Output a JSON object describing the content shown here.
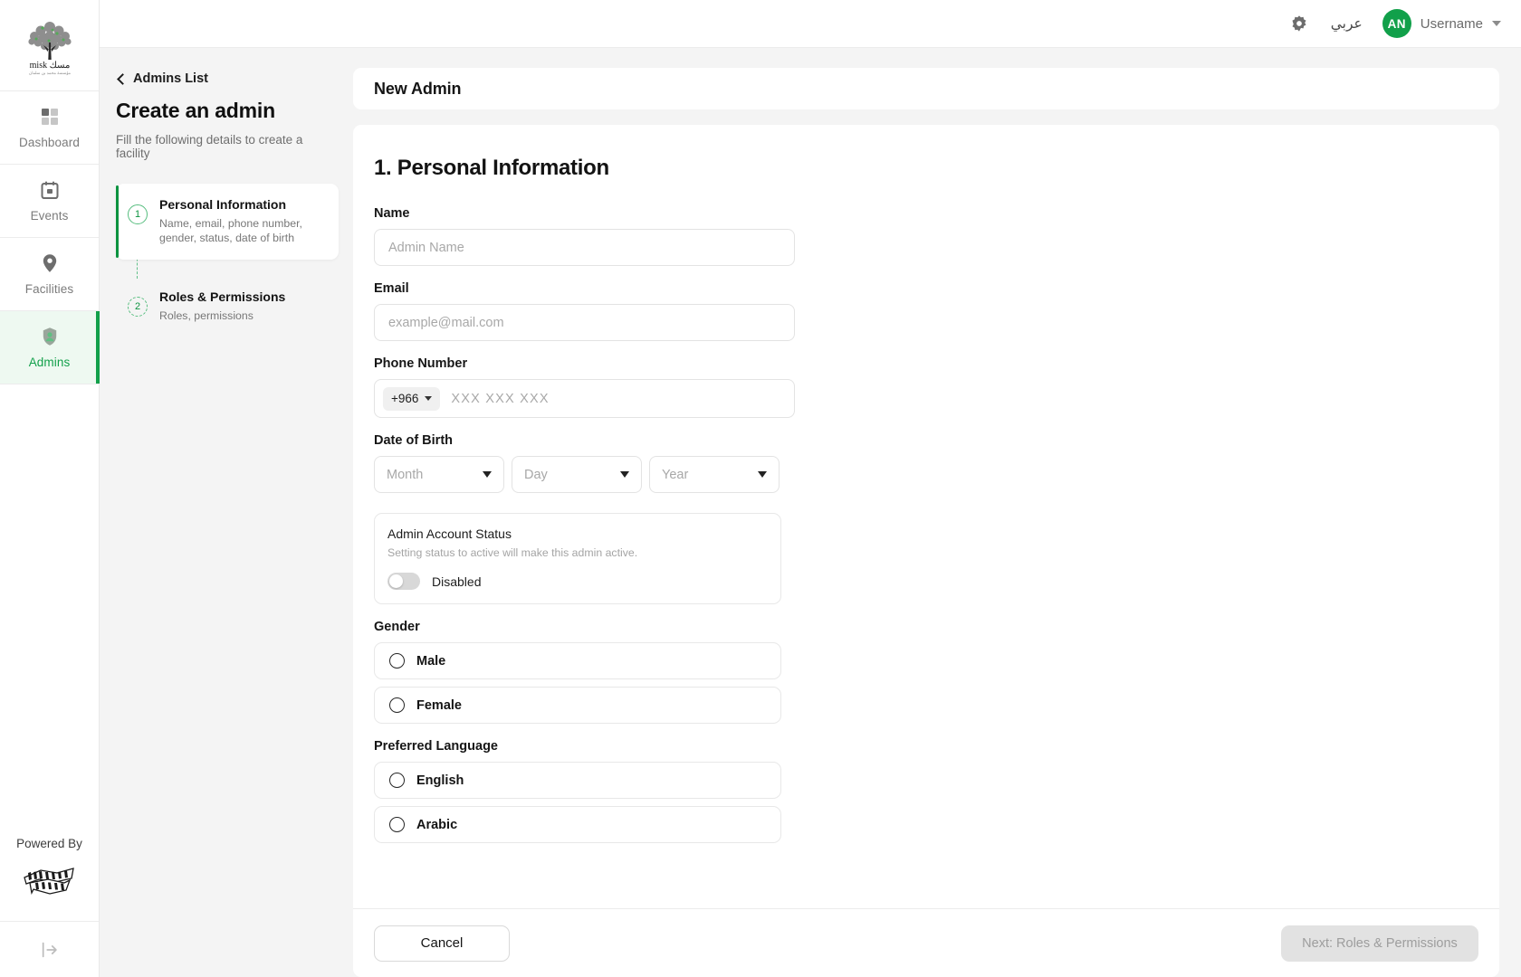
{
  "brand": {
    "logo_name": "misk-logo",
    "logo_wordmark": "misk",
    "accent_green": "#11a04a",
    "step_green": "#0c9340",
    "avatar_green": "#11a04a"
  },
  "sidebar": {
    "items": [
      {
        "label": "Dashboard",
        "icon": "grid-icon",
        "active": false
      },
      {
        "label": "Events",
        "icon": "calendar-icon",
        "active": false
      },
      {
        "label": "Facilities",
        "icon": "map-pin-icon",
        "active": false
      },
      {
        "label": "Admins",
        "icon": "shield-user-icon",
        "active": true
      }
    ],
    "powered_by_label": "Powered By",
    "powered_by_logo": "hala-yalla-logo",
    "collapse_icon": "collapse-sidebar-icon"
  },
  "topbar": {
    "settings_icon": "gear-icon",
    "language_toggle": "عربي",
    "avatar_initials": "AN",
    "username": "Username",
    "dropdown_icon": "chevron-down-icon"
  },
  "stepspane": {
    "back_link": "Admins List",
    "title": "Create an admin",
    "subtitle": "Fill the following details to create a facility",
    "steps": [
      {
        "number": "1",
        "title": "Personal Information",
        "desc": "Name, email, phone number, gender, status, date of birth",
        "state": "current"
      },
      {
        "number": "2",
        "title": "Roles & Permissions",
        "desc": "Roles, permissions",
        "state": "upcoming"
      }
    ]
  },
  "page": {
    "header_title": "New Admin",
    "section_title": "1. Personal Information"
  },
  "form": {
    "name": {
      "label": "Name",
      "placeholder": "Admin Name",
      "value": ""
    },
    "email": {
      "label": "Email",
      "placeholder": "example@mail.com",
      "value": ""
    },
    "phone": {
      "label": "Phone Number",
      "country_code": "+966",
      "placeholder": "XXX XXX XXX",
      "value": ""
    },
    "dob": {
      "label": "Date of Birth",
      "month": "Month",
      "day": "Day",
      "year": "Year"
    },
    "status": {
      "title": "Admin Account Status",
      "description": "Setting status to active will make this admin active.",
      "toggle_state": "off",
      "toggle_label": "Disabled"
    },
    "gender": {
      "label": "Gender",
      "options": [
        {
          "label": "Male",
          "selected": false
        },
        {
          "label": "Female",
          "selected": false
        }
      ]
    },
    "language": {
      "label": "Preferred Language",
      "options": [
        {
          "label": "English",
          "selected": false
        },
        {
          "label": "Arabic",
          "selected": false
        }
      ]
    }
  },
  "footer": {
    "cancel_label": "Cancel",
    "next_label": "Next: Roles & Permissions",
    "next_disabled": true
  }
}
